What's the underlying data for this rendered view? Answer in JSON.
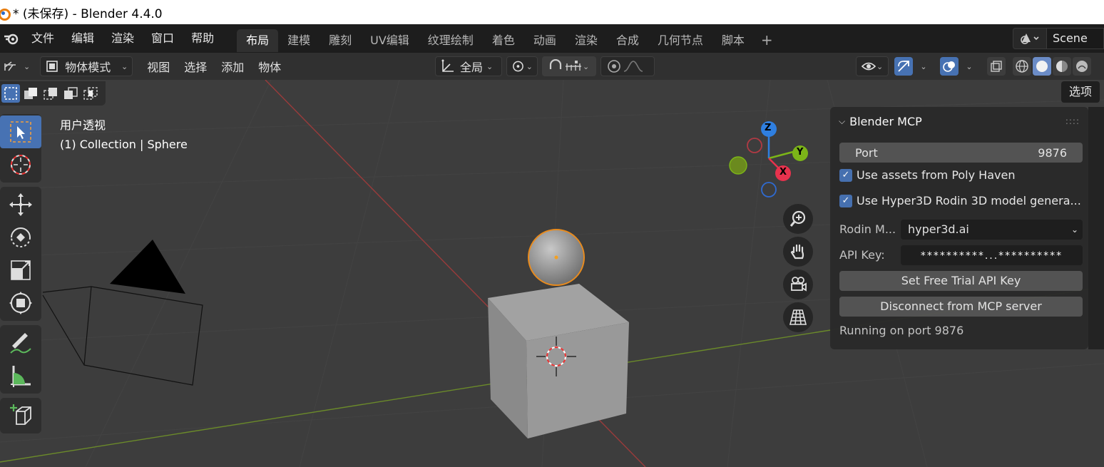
{
  "window": {
    "title": "* (未保存) - Blender 4.4.0"
  },
  "menubar": {
    "items": [
      "文件",
      "编辑",
      "渲染",
      "窗口",
      "帮助"
    ],
    "workspaces": [
      "布局",
      "建模",
      "雕刻",
      "UV编辑",
      "纹理绘制",
      "着色",
      "动画",
      "渲染",
      "合成",
      "几何节点",
      "脚本"
    ],
    "active_workspace": "布局",
    "add_workspace": "+",
    "scene_name": "Scene"
  },
  "viewport_header": {
    "mode": "物体模式",
    "menus": [
      "视图",
      "选择",
      "添加",
      "物体"
    ],
    "transform_orientation": "全局"
  },
  "viewport": {
    "view_name": "用户透视",
    "collection_info": "(1) Collection | Sphere",
    "options_label": "选项",
    "gizmo": {
      "z": "Z",
      "y": "Y",
      "x": "X"
    }
  },
  "mcp_panel": {
    "title": "Blender MCP",
    "port_label": "Port",
    "port_value": "9876",
    "use_polyhaven_label": "Use assets from Poly Haven",
    "use_polyhaven_checked": true,
    "use_hyper3d_label": "Use Hyper3D Rodin 3D model genera...",
    "use_hyper3d_checked": true,
    "rodin_mode_label": "Rodin M...",
    "rodin_mode_value": "hyper3d.ai",
    "api_key_label": "API Key:",
    "api_key_value": "**********...**********",
    "set_trial_key_label": "Set Free Trial API Key",
    "disconnect_label": "Disconnect from MCP server",
    "status_text": "Running on port 9876"
  },
  "colors": {
    "accent_blue": "#4772b3",
    "selection_orange": "#e88b1e",
    "axis_x": "#e8324d",
    "axis_y": "#7cb518",
    "axis_z": "#2f7fe0"
  }
}
